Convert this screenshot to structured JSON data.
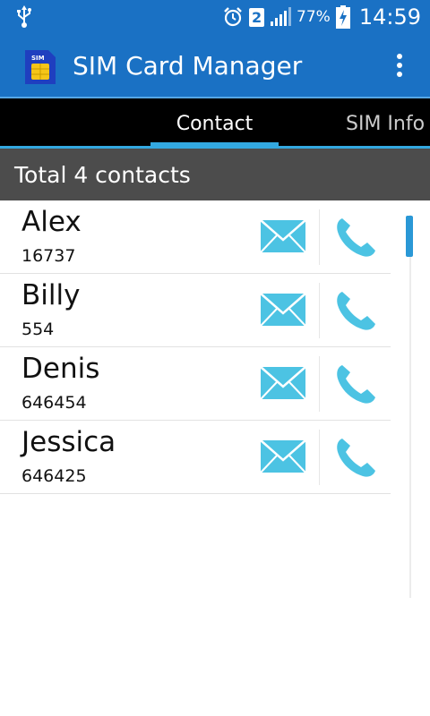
{
  "status_bar": {
    "sim_slot": "2",
    "battery": "77%",
    "time": "14:59"
  },
  "app_bar": {
    "title": "SIM Card Manager",
    "logo_text": "SIM"
  },
  "tabs": [
    {
      "label": "Contact",
      "active": true
    },
    {
      "label": "SIM Info",
      "active": false
    }
  ],
  "section": {
    "header": "Total 4 contacts"
  },
  "contacts": [
    {
      "name": "Alex",
      "number": "16737"
    },
    {
      "name": "Billy",
      "number": "554"
    },
    {
      "name": "Denis",
      "number": "646454"
    },
    {
      "name": "Jessica",
      "number": "646425"
    }
  ],
  "colors": {
    "primary": "#1a71c4",
    "accent": "#33a8e0",
    "icon": "#4cc3e3",
    "header": "#4c4c4c"
  },
  "icons": {
    "sms": "envelope-icon",
    "call": "phone-handset-icon"
  }
}
